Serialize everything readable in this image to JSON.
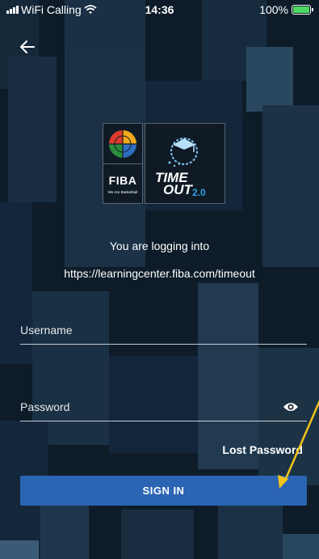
{
  "status_bar": {
    "carrier": "WiFi Calling",
    "time": "14:36",
    "battery": "100%"
  },
  "login": {
    "heading": "You are logging into",
    "url": "https://learningcenter.fiba.com/timeout",
    "username_label": "Username",
    "password_label": "Password",
    "lost_password": "Lost Password",
    "sign_in": "SIGN IN"
  },
  "logos": {
    "fiba": "FIBA",
    "fiba_tagline": "We Are Basketball",
    "timeout_line1": "TIME",
    "timeout_line2": "OUT",
    "timeout_version": "2.0"
  },
  "colors": {
    "background": "#0b1622",
    "tile": "#1c3346",
    "primary_button": "#2b64b3",
    "annotation_arrow": "#f2c318"
  },
  "icons": {
    "back": "arrow-left-icon",
    "password_visibility": "eye-icon",
    "wifi": "wifi-icon",
    "battery": "battery-icon"
  }
}
